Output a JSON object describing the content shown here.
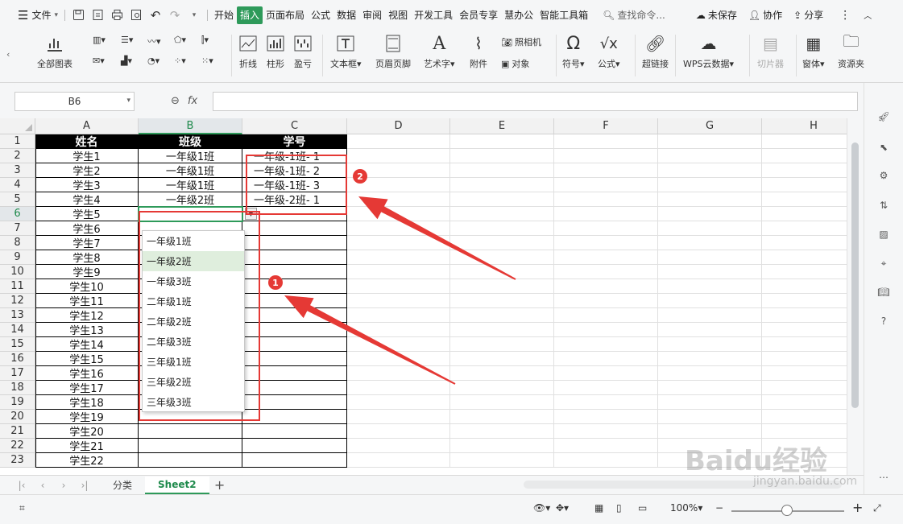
{
  "menubar": {
    "file_label": "文件",
    "tabs": [
      "开始",
      "插入",
      "页面布局",
      "公式",
      "数据",
      "审阅",
      "视图",
      "开发工具",
      "会员专享",
      "慧办公",
      "智能工具箱"
    ],
    "active_tab": "插入",
    "search_placeholder": "查找命令...",
    "unsaved_label": "未保存",
    "collab_label": "协作",
    "share_label": "分享"
  },
  "ribbon": {
    "all_charts": "全部图表",
    "line": "折线",
    "column": "柱形",
    "winloss": "盈亏",
    "textbox": "文本框",
    "header_footer": "页眉页脚",
    "wordart": "艺术字",
    "attachment": "附件",
    "camera": "照相机",
    "object": "对象",
    "symbol": "符号",
    "formula": "公式",
    "hyperlink": "超链接",
    "wps_cloud": "WPS云数据",
    "slicer": "切片器",
    "form": "窗体",
    "resource": "资源夹"
  },
  "formulabar": {
    "name_box": "B6",
    "fx_label": "fx",
    "formula_value": ""
  },
  "grid": {
    "columns": [
      "A",
      "B",
      "C",
      "D",
      "E",
      "F",
      "G",
      "H"
    ],
    "rows": [
      "1",
      "2",
      "3",
      "4",
      "5",
      "6",
      "7",
      "8",
      "9",
      "10",
      "11",
      "12",
      "13",
      "14",
      "15",
      "16",
      "17",
      "18",
      "19",
      "20",
      "21",
      "22",
      "23"
    ],
    "selected_column": "B",
    "selected_row": "6",
    "header": [
      "姓名",
      "班级",
      "学号"
    ],
    "col_a": [
      "学生1",
      "学生2",
      "学生3",
      "学生4",
      "学生5",
      "学生6",
      "学生7",
      "学生8",
      "学生9",
      "学生10",
      "学生11",
      "学生12",
      "学生13",
      "学生14",
      "学生15",
      "学生16",
      "学生17",
      "学生18",
      "学生19",
      "学生20",
      "学生21",
      "学生22"
    ],
    "col_b": [
      "一年级1班",
      "一年级1班",
      "一年级1班",
      "一年级2班"
    ],
    "col_c": [
      "一年级-1班- 1",
      "一年级-1班- 2",
      "一年级-1班- 3",
      "一年级-2班- 1"
    ]
  },
  "dropdown": {
    "options": [
      "一年级1班",
      "一年级2班",
      "一年级3班",
      "二年级1班",
      "二年级2班",
      "二年级3班",
      "三年级1班",
      "三年级2班",
      "三年级3班"
    ],
    "highlighted": "一年级2班"
  },
  "annotations": {
    "badge1": "1",
    "badge2": "2",
    "color": "#e53935"
  },
  "sheets": {
    "tabs": [
      "分类",
      "Sheet2"
    ],
    "active": "Sheet2"
  },
  "statusbar": {
    "zoom": "100%"
  },
  "watermark": {
    "main": "Baidu经验",
    "url": "jingyan.baidu.com"
  },
  "colors": {
    "accent": "#2e9a5a",
    "header_bg": "#000000",
    "highlight": "#dfeedd"
  }
}
